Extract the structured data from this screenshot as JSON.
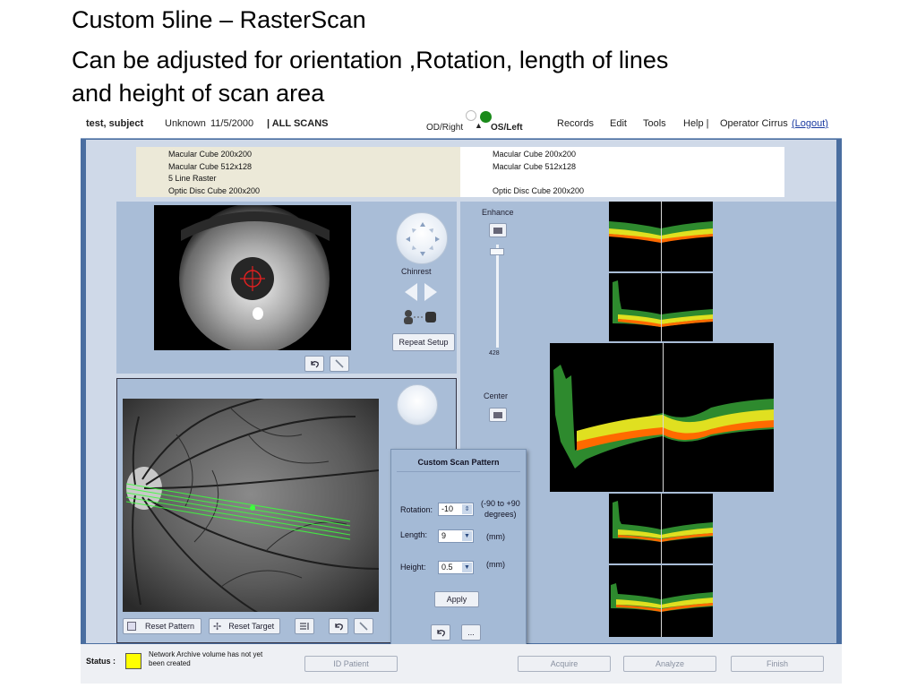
{
  "slide": {
    "title_line1": "Custom 5line – RasterScan",
    "title_line2": "Can be adjusted for  orientation ,Rotation, length of lines",
    "title_line3": "and height of scan area"
  },
  "header": {
    "patient_name": "test, subject",
    "patient_gender": "Unknown",
    "patient_dob": "11/5/2000",
    "scans_label": "| ALL SCANS",
    "eye_od": "OD/Right",
    "eye_os": "OS/Left",
    "menu": [
      "Records",
      "Edit",
      "Tools",
      "Help |",
      "Operator Cirrus",
      "(Logout)"
    ]
  },
  "scan_list_od": [
    "Macular Cube 200x200",
    "Macular Cube 512x128",
    "5 Line Raster",
    "Optic Disc Cube 200x200"
  ],
  "scan_list_os": [
    "Macular Cube 200x200",
    "Macular Cube 512x128",
    "",
    "Optic Disc Cube 200x200"
  ],
  "controls": {
    "chinrest_label": "Chinrest",
    "repeat_setup_label": "Repeat Setup",
    "enhance_label": "Enhance",
    "enhance_value": "428",
    "center_label": "Center",
    "reset_pattern_label": "Reset Pattern",
    "reset_target_label": "Reset Target"
  },
  "dialog": {
    "title": "Custom Scan Pattern",
    "rotation_label": "Rotation:",
    "rotation_value": "-10",
    "rotation_range_line1": "(-90 to +90",
    "rotation_range_line2": "degrees)",
    "length_label": "Length:",
    "length_value": "9",
    "length_unit": "(mm)",
    "height_label": "Height:",
    "height_value": "0.5",
    "height_unit": "(mm)",
    "apply_label": "Apply",
    "more_label": "..."
  },
  "status": {
    "label": "Status :",
    "message_line1": "Network Archive volume has not yet",
    "message_line2": "been created",
    "status_color": "#ffff00",
    "buttons": [
      "ID Patient",
      "Acquire",
      "Analyze",
      "Finish"
    ]
  },
  "colors": {
    "window_frame": "#4a6ea0",
    "panel": "#a9bdd7",
    "scan_overlay": "#3cff3c",
    "od_indicator": "#ffffff",
    "os_indicator": "#1a8a1a"
  },
  "icons": [
    "undo-icon",
    "wrench-icon",
    "arrow-left-icon",
    "arrow-right-icon",
    "patient-camera-icon",
    "list-icon",
    "dial-icon"
  ]
}
